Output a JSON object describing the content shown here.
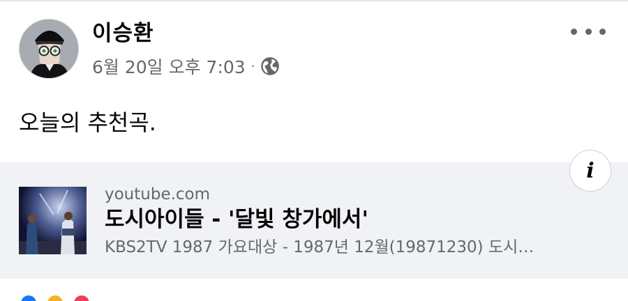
{
  "post": {
    "author": "이승환",
    "timestamp": "6월 20일 오후 7:03",
    "separator": "·",
    "privacy_icon": "globe-icon",
    "more_icon": "more-options-icon",
    "text": "오늘의 추천곡."
  },
  "link_preview": {
    "domain": "youtube.com",
    "title": "도시아이들 - '달빛 창가에서'",
    "description": "KBS2TV 1987 가요대상 - 1987년 12월(19871230) 도시…",
    "info_label": "i"
  },
  "reactions": {
    "icons": [
      "like-reaction-icon",
      "haha-reaction-icon",
      "love-reaction-icon"
    ],
    "colors": [
      "#1877f2",
      "#f7b125",
      "#f33e58"
    ]
  },
  "colors": {
    "text_primary": "#050505",
    "text_secondary": "#65676b",
    "preview_bg": "#f0f2f5"
  }
}
